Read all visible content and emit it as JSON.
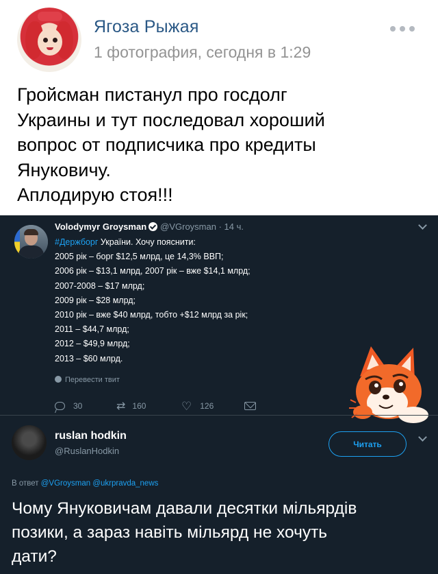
{
  "post": {
    "author": "Ягоза Рыжая",
    "meta": "1 фотография, сегодня в 1:29",
    "text_lines": [
      "Гройсман пистанул про госдолг",
      "Украины и тут последовал хороший",
      "вопрос от подписчика про кредиты",
      "Януковичу.",
      "Аплодирую стоя!!!"
    ]
  },
  "tweet": {
    "name": "Volodymyr Groysman",
    "handle_time": "@VGroysman · 14 ч.",
    "hashtag": "#Держборг",
    "first_line_rest": " України. Хочу пояснити:",
    "lines": [
      "2005 рік – борг $12,5 млрд, це 14,3% ВВП;",
      "2006 рік – $13,1 млрд, 2007 рік – вже $14,1 млрд;",
      "2007-2008 – $17 млрд;",
      "2009 рік – $28 млрд;",
      "2010 рік – вже $40 млрд, тобто +$12 млрд за рік;",
      "2011 – $44,7 млрд;",
      "2012 – $49,9 млрд;",
      "2013 – $60 млрд."
    ],
    "translate": "Перевести твит",
    "replies": "30",
    "retweets": "160",
    "likes": "126"
  },
  "reply": {
    "name": "ruslan hodkin",
    "handle": "@RuslanHodkin",
    "follow_label": "Читать",
    "reply_prefix": "В ответ ",
    "mentions": "@VGroysman @ukrpravda_news",
    "text_lines": [
      "Чому Януковичам давали десятки мільярдів",
      "позики, а зараз навіть мільярд не хочуть",
      "дати?"
    ]
  },
  "colors": {
    "vk_link": "#2a5885",
    "twitter_bg": "#15202b",
    "twitter_blue": "#1da1f2",
    "twitter_grey": "#8899a6"
  }
}
